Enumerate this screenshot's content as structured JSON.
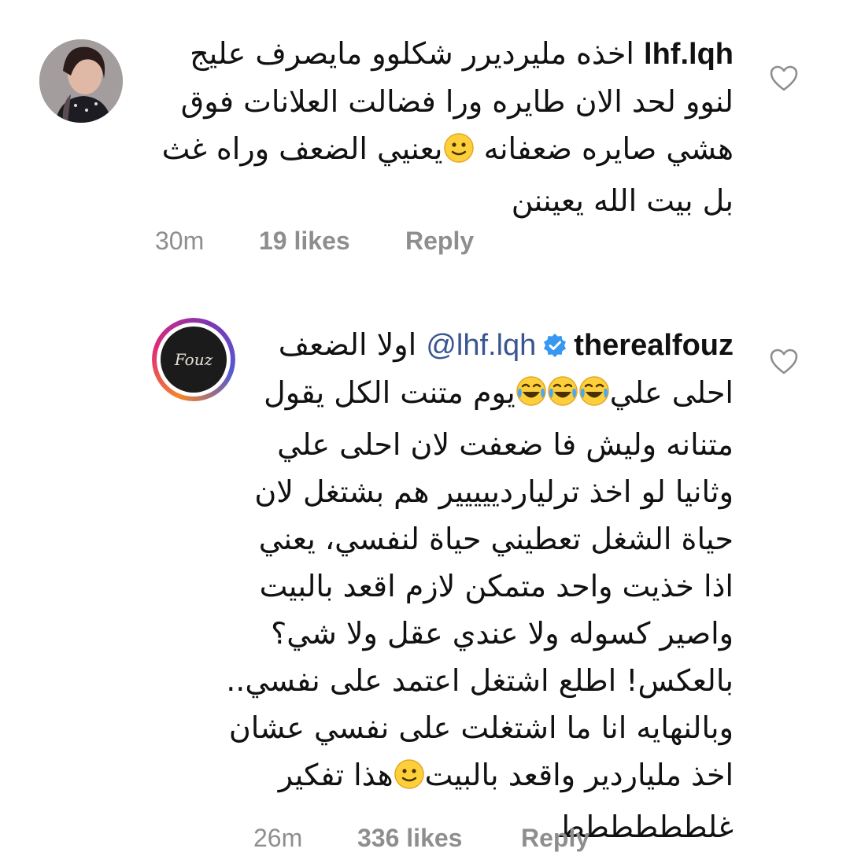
{
  "comments": [
    {
      "username": "lhf.lqh",
      "lines": [
        "اخذه مليرديرر  شكلوو مايصرف عليج",
        "لنوو لحد الان طايره ورا فضالت العلانات فوق",
        "هشي  صايره ضعفانه يعنيي  الضعف وراه غث",
        "بل بيت الله يعيننن"
      ],
      "time": "30m",
      "likes": "19 likes",
      "reply": "Reply"
    },
    {
      "username": "therealfouz",
      "mention": "@lhf.lqh",
      "first_line": "اولا الضعف",
      "lines": [
        "احلى علي يوم متنت الكل يقول",
        "متنانه وليش فا ضعفت لان احلى علي",
        "وثانيا لو اخذ ترلياردييييير هم بشتغل لان",
        "حياة الشغل تعطيني حياة لنفسي، يعني",
        "اذا خذيت واحد متمكن لازم اقعد بالبيت",
        "واصير كسوله ولا عندي عقل ولا شي؟",
        "بالعكس! اطلع اشتغل اعتمد على نفسي..",
        "وبالنهايه انا ما اشتغلت على نفسي عشان",
        "اخذ ملياردير واقعد بالبيت هذا تفكير",
        "غلطططططط"
      ],
      "avatar_text": "Fouz",
      "time": "26m",
      "likes": "336 likes",
      "reply": "Reply"
    }
  ],
  "icons": {
    "like": "heart-icon",
    "verified": "verified-badge-icon",
    "emoji_smile": "slightly-smiling-emoji",
    "emoji_laugh": "tears-of-joy-emoji"
  },
  "colors": {
    "mention": "#3a5590",
    "verified": "#3897f0",
    "meta": "#8e8e8e"
  }
}
